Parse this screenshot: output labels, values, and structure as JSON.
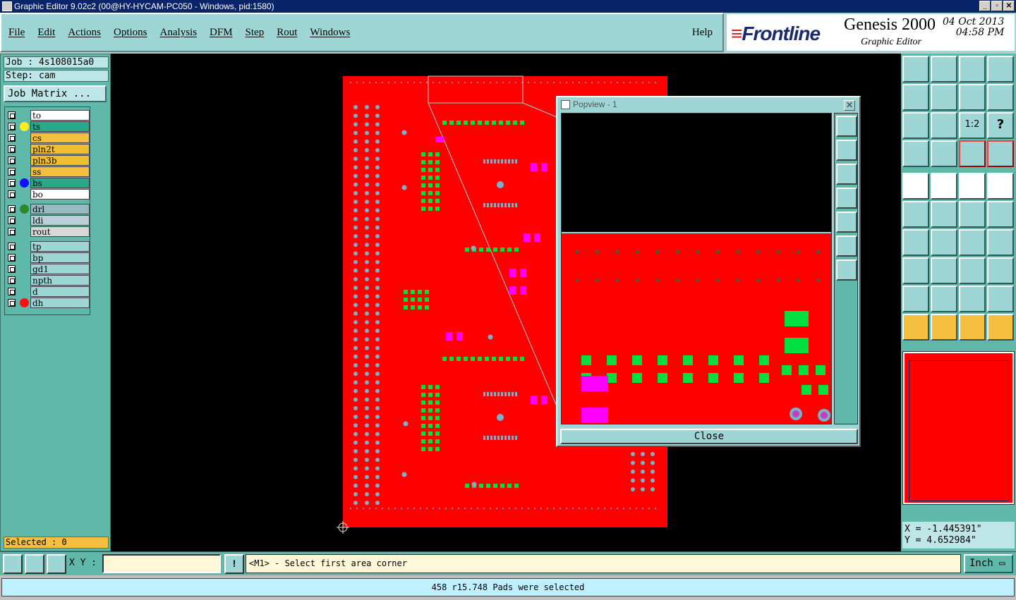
{
  "window": {
    "title": "Graphic Editor 9.02c2 (00@HY-HYCAM-PC050 - Windows, pid:1580)"
  },
  "menu": {
    "items": [
      "File",
      "Edit",
      "Actions",
      "Options",
      "Analysis",
      "DFM",
      "Step",
      "Rout",
      "Windows"
    ],
    "help": "Help"
  },
  "brand": {
    "logo": "Frontline",
    "product": "Genesis 2000",
    "subtitle": "Graphic Editor",
    "date": "04 Oct 2013",
    "time": "04:58 PM"
  },
  "job": {
    "job": "Job : 4s108015a0",
    "step": "Step: cam",
    "matrix_button": "Job Matrix ..."
  },
  "layers": [
    {
      "name": "to",
      "color": "#ffffff",
      "dot": ""
    },
    {
      "name": "ts",
      "color": "#2aa88a",
      "dot": "#ffee22"
    },
    {
      "name": "cs",
      "color": "#f5c040",
      "dot": ""
    },
    {
      "name": "pln2t",
      "color": "#f0c030",
      "dot": ""
    },
    {
      "name": "pln3b",
      "color": "#f0c030",
      "dot": ""
    },
    {
      "name": "ss",
      "color": "#f5c040",
      "dot": ""
    },
    {
      "name": "bs",
      "color": "#2aa88a",
      "dot": "#1010ff"
    },
    {
      "name": "bo",
      "color": "#ffffff",
      "dot": ""
    },
    {
      "name": "drl",
      "color": "#9ab8c0",
      "dot": "#2a8a2a"
    },
    {
      "name": "ldi",
      "color": "#b8d0d8",
      "dot": ""
    },
    {
      "name": "rout",
      "color": "#d8d8d8",
      "dot": ""
    },
    {
      "name": "tp",
      "color": "#9ed6d6",
      "dot": ""
    },
    {
      "name": "bp",
      "color": "#9ed6d6",
      "dot": ""
    },
    {
      "name": "gd1",
      "color": "#9ed6d6",
      "dot": ""
    },
    {
      "name": "npth",
      "color": "#9ed6d6",
      "dot": ""
    },
    {
      "name": "d",
      "color": "#9ed6d6",
      "dot": ""
    },
    {
      "name": "dh",
      "color": "#9ed6d6",
      "dot": "#ff1010"
    }
  ],
  "selected": "Selected : 0",
  "popview": {
    "title": "Popview - 1",
    "close_label": "Close"
  },
  "tools_right": {
    "ratio_label": "1:2",
    "help_label": "?"
  },
  "coords": {
    "x": "X = -1.445391\"",
    "y": "Y = 4.652984\""
  },
  "bottom": {
    "xy_label": "X Y :",
    "xy_value": "",
    "message": "<M1> - Select first area corner",
    "unit": "Inch"
  },
  "status": "458 r15.748 Pads were selected",
  "colors": {
    "board": "#ff0000",
    "pad_green": "#00e040",
    "pad_magenta": "#ff00ff",
    "drill": "#7ab0c8",
    "panel": "#5fb8a8",
    "panel_light": "#9ed6d6"
  }
}
